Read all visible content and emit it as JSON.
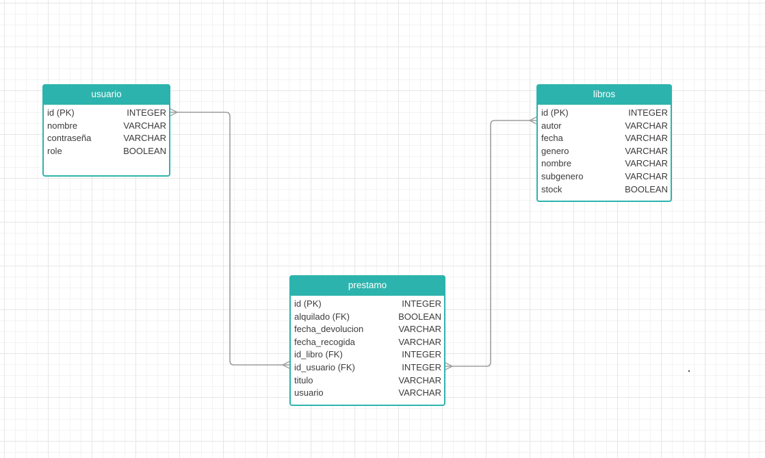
{
  "entities": [
    {
      "id": "usuario",
      "title": "usuario",
      "fields": [
        {
          "name": "id (PK)",
          "type": "INTEGER"
        },
        {
          "name": "nombre",
          "type": "VARCHAR"
        },
        {
          "name": "contraseña",
          "type": "VARCHAR"
        },
        {
          "name": "role",
          "type": "BOOLEAN"
        }
      ]
    },
    {
      "id": "libros",
      "title": "libros",
      "fields": [
        {
          "name": "id  (PK)",
          "type": "INTEGER"
        },
        {
          "name": "autor",
          "type": "VARCHAR"
        },
        {
          "name": "fecha",
          "type": "VARCHAR"
        },
        {
          "name": "genero",
          "type": "VARCHAR"
        },
        {
          "name": "nombre",
          "type": "VARCHAR"
        },
        {
          "name": "subgenero",
          "type": "VARCHAR"
        },
        {
          "name": "stock",
          "type": "BOOLEAN"
        }
      ]
    },
    {
      "id": "prestamo",
      "title": "prestamo",
      "fields": [
        {
          "name": "id (PK)",
          "type": "INTEGER"
        },
        {
          "name": "alquilado (FK)",
          "type": "BOOLEAN"
        },
        {
          "name": "fecha_devolucion",
          "type": "VARCHAR"
        },
        {
          "name": "fecha_recogida",
          "type": "VARCHAR"
        },
        {
          "name": "id_libro (FK)",
          "type": "INTEGER"
        },
        {
          "name": "id_usuario (FK)",
          "type": "INTEGER"
        },
        {
          "name": "titulo",
          "type": "VARCHAR"
        },
        {
          "name": "usuario",
          "type": "VARCHAR"
        }
      ]
    }
  ],
  "relationships": [
    {
      "from": "usuario",
      "from_field": "id (PK)",
      "to": "prestamo",
      "to_field": "id_usuario (FK)",
      "from_end": "many",
      "to_end": "many"
    },
    {
      "from": "libros",
      "from_field": "id  (PK)",
      "to": "prestamo",
      "to_field": "id_libro (FK)",
      "from_end": "many",
      "to_end": "many"
    }
  ],
  "colors": {
    "entity_header": "#2db3ad",
    "entity_border": "#2db3ad",
    "connector": "#9e9e9e"
  }
}
